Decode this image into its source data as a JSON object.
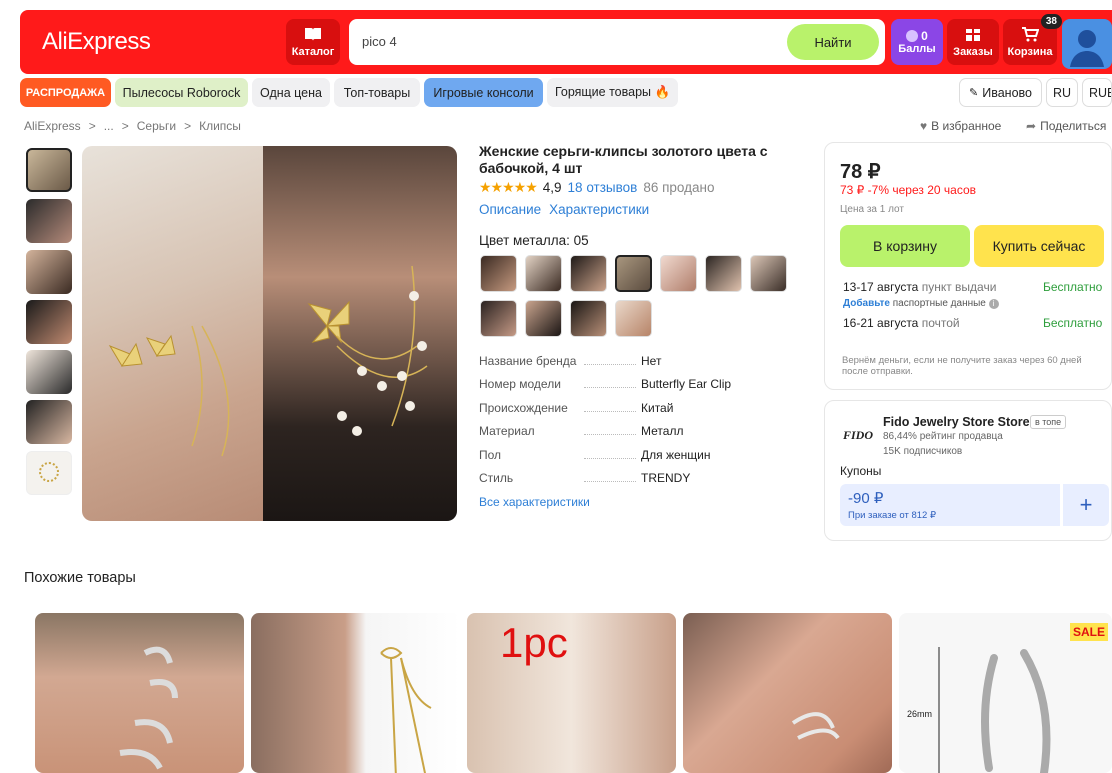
{
  "header": {
    "logo": "AliExpress",
    "catalog_label": "Каталог",
    "search_value": "pico 4",
    "search_button": "Найти",
    "points_value": "0",
    "points_label": "Баллы",
    "orders_label": "Заказы",
    "cart_label": "Корзина",
    "cart_count": "38"
  },
  "chips": [
    "РАСПРОДАЖА",
    "Пылесосы Roborock",
    "Одна цена",
    "Топ-товары",
    "Игровые консоли",
    "Горящие товары 🔥"
  ],
  "top_right": {
    "location": "Иваново",
    "lang": "RU",
    "currency": "RUB"
  },
  "breadcrumbs": [
    "AliExpress",
    ">",
    "...",
    ">",
    "Серьги",
    ">",
    "Клипсы"
  ],
  "actions": {
    "favorite": "В избранное",
    "share": "Поделиться"
  },
  "product": {
    "title": "Женские серьги-клипсы золотого цвета с бабочкой, 4 шт",
    "stars": "★★★★★",
    "rating": "4,9",
    "reviews": "18 отзывов",
    "sold": "86 продано",
    "link_description": "Описание",
    "link_specs": "Характеристики",
    "metal_label": "Цвет металла: 05",
    "specs": [
      {
        "k": "Название бренда",
        "v": "Нет"
      },
      {
        "k": "Номер модели",
        "v": "Butterfly Ear Clip"
      },
      {
        "k": "Происхождение",
        "v": "Китай"
      },
      {
        "k": "Материал",
        "v": "Металл"
      },
      {
        "k": "Пол",
        "v": "Для женщин"
      },
      {
        "k": "Стиль",
        "v": "TRENDY"
      }
    ],
    "all_specs": "Все характеристики"
  },
  "buybox": {
    "price": "78 ₽",
    "old_price": "73 ₽",
    "discount": "-7%",
    "timer": "через 20 часов",
    "lot": "Цена за 1 лот",
    "cart_button": "В корзину",
    "buy_button": "Купить сейчас",
    "delivery1_date": "13-17 августа",
    "delivery1_type": "пункт выдачи",
    "delivery1_price": "Бесплатно",
    "passport_add": "Добавьте",
    "passport_text": "паспортные данные",
    "delivery2_date": "16-21 августа",
    "delivery2_type": "почтой",
    "delivery2_price": "Бесплатно",
    "refund": "Вернём деньги, если не получите заказ через 60 дней после отправки."
  },
  "store": {
    "logo": "FIDO",
    "name": "Fido Jewelry Store Store",
    "tag": "в топе",
    "rating": "86,44% рейтинг продавца",
    "subs": "15K подписчиков",
    "coupons_label": "Купоны",
    "coupon_value": "-90 ₽",
    "coupon_cond": "При заказе от 812 ₽",
    "plus": "+"
  },
  "similar": {
    "title": "Похожие товары",
    "card3_overlay": "1pc",
    "card4_sale": "SALE",
    "card5_dim": "26mm"
  },
  "colors": {
    "brand": "#ff1a1a",
    "green": "#b9f26b",
    "yellow": "#ffe34d",
    "link": "#2e7fd6"
  }
}
